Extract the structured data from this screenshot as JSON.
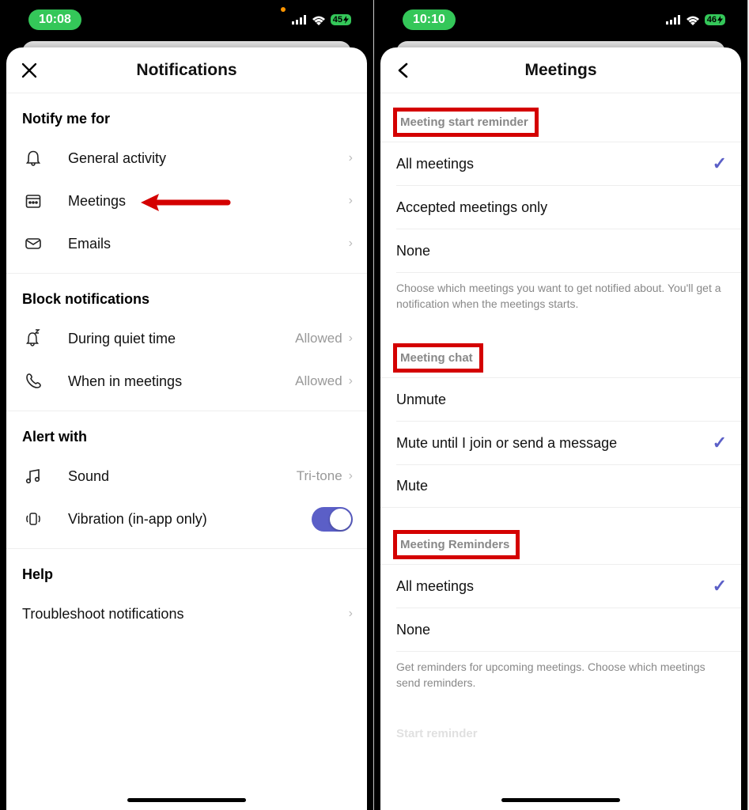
{
  "left": {
    "status": {
      "time": "10:08",
      "battery": "45"
    },
    "title": "Notifications",
    "sec_notify": "Notify me for",
    "items_notify": [
      {
        "label": "General activity"
      },
      {
        "label": "Meetings"
      },
      {
        "label": "Emails"
      }
    ],
    "sec_block": "Block notifications",
    "items_block": [
      {
        "label": "During quiet time",
        "value": "Allowed"
      },
      {
        "label": "When in meetings",
        "value": "Allowed"
      }
    ],
    "sec_alert": "Alert with",
    "items_alert": [
      {
        "label": "Sound",
        "value": "Tri-tone"
      },
      {
        "label": "Vibration (in-app only)"
      }
    ],
    "sec_help": "Help",
    "items_help": [
      {
        "label": "Troubleshoot notifications"
      }
    ]
  },
  "right": {
    "status": {
      "time": "10:10",
      "battery": "46"
    },
    "title": "Meetings",
    "sec_start": "Meeting start reminder",
    "items_start": [
      {
        "label": "All meetings",
        "selected": true
      },
      {
        "label": "Accepted meetings only"
      },
      {
        "label": "None"
      }
    ],
    "footer_start": "Choose which meetings you want to get notified about. You'll get a notification when the meetings starts.",
    "sec_chat": "Meeting chat",
    "items_chat": [
      {
        "label": "Unmute"
      },
      {
        "label": "Mute until I join or send a message",
        "selected": true
      },
      {
        "label": "Mute"
      }
    ],
    "sec_rem": "Meeting Reminders",
    "items_rem": [
      {
        "label": "All meetings",
        "selected": true
      },
      {
        "label": "None"
      }
    ],
    "footer_rem": "Get reminders for upcoming meetings. Choose which meetings send reminders.",
    "cutoff": "Start reminder"
  }
}
